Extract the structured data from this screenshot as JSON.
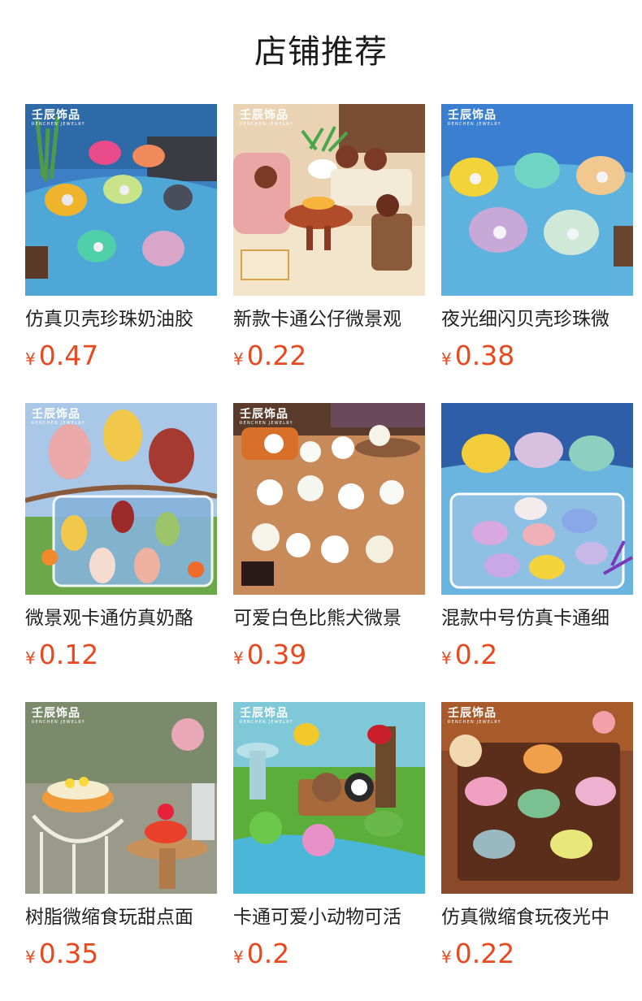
{
  "header": {
    "title": "店铺推荐"
  },
  "brand": {
    "cn": "壬辰饰品",
    "en": "RENCHEN JEWELRY"
  },
  "currency_symbol": "¥",
  "products": [
    {
      "name": "仿真贝壳珍珠奶油胶",
      "price": "0.47"
    },
    {
      "name": "新款卡通公仔微景观",
      "price": "0.22"
    },
    {
      "name": "夜光细闪贝壳珍珠微",
      "price": "0.38"
    },
    {
      "name": "微景观卡通仿真奶酪",
      "price": "0.12"
    },
    {
      "name": "可爱白色比熊犬微景",
      "price": "0.39"
    },
    {
      "name": "混款中号仿真卡通细",
      "price": "0.2"
    },
    {
      "name": "树脂微缩食玩甜点面",
      "price": "0.35"
    },
    {
      "name": "卡通可爱小动物可活",
      "price": "0.2"
    },
    {
      "name": "仿真微缩食玩夜光中",
      "price": "0.22"
    }
  ],
  "colors": {
    "price": "#e8491f",
    "title": "#1a1a1a"
  }
}
